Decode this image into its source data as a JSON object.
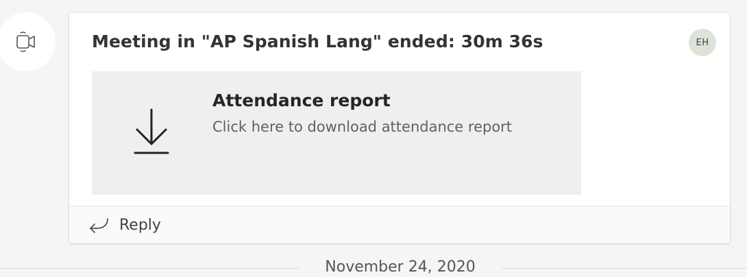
{
  "meeting_event": {
    "icon": "video-camera-icon"
  },
  "message": {
    "title": "Meeting in \"AP Spanish Lang\" ended: 30m 36s",
    "avatar_initials": "EH",
    "attachment": {
      "icon": "download-icon",
      "title": "Attendance report",
      "subtitle": "Click here to download attendance report"
    },
    "reply": {
      "icon": "reply-arrow-icon",
      "label": "Reply"
    }
  },
  "date_separator": {
    "label": "November 24, 2020"
  },
  "colors": {
    "background": "#f5f5f5",
    "card": "#ffffff",
    "attachment_bg": "#efefef",
    "avatar_bg": "#dce3d8"
  }
}
